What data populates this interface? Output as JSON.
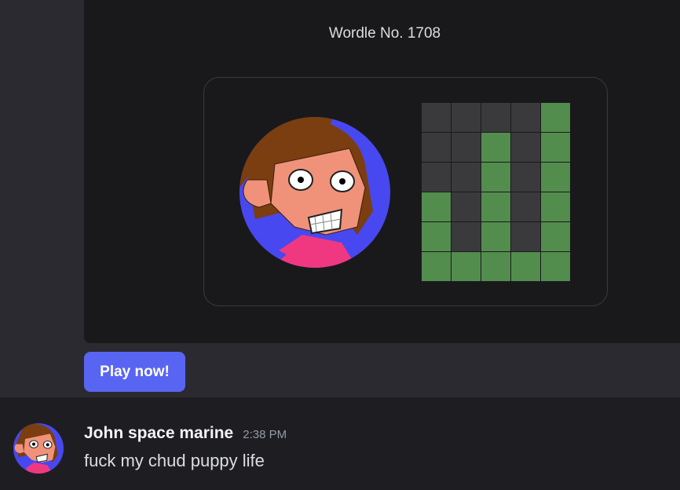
{
  "embed": {
    "title": "Wordle No. 1708",
    "avatar_icon": "cartoon-face-avatar",
    "grid": [
      [
        "absent",
        "absent",
        "absent",
        "absent",
        "correct"
      ],
      [
        "absent",
        "absent",
        "correct",
        "absent",
        "correct"
      ],
      [
        "absent",
        "absent",
        "correct",
        "absent",
        "correct"
      ],
      [
        "correct",
        "absent",
        "correct",
        "absent",
        "correct"
      ],
      [
        "correct",
        "absent",
        "correct",
        "absent",
        "correct"
      ],
      [
        "correct",
        "correct",
        "correct",
        "correct",
        "correct"
      ]
    ],
    "colors": {
      "correct": "#538d4e",
      "absent": "#3a3a3d"
    }
  },
  "play_button": {
    "label": "Play now!",
    "color": "#5865f2"
  },
  "message": {
    "username": "John space marine",
    "timestamp": "2:38 PM",
    "text": "fuck my chud puppy life",
    "avatar_icon": "cartoon-face-avatar"
  }
}
